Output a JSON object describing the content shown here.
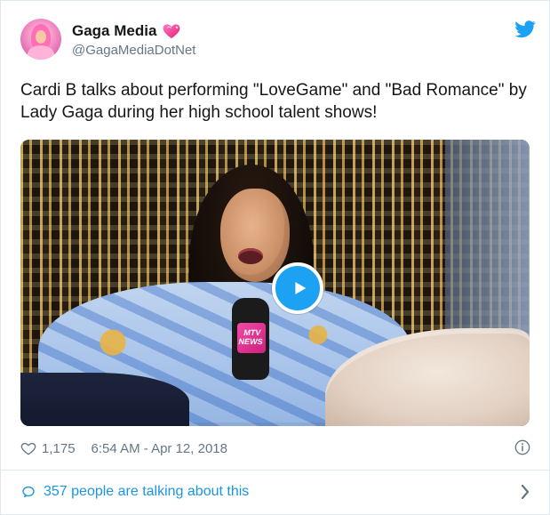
{
  "tweet": {
    "author": {
      "name": "Gaga Media",
      "handle": "@GagaMediaDotNet",
      "name_icon": "sparkling-heart-icon"
    },
    "platform_icon": "twitter-bird-icon",
    "text": "Cardi B talks about performing \"LoveGame\" and \"Bad Romance\" by Lady Gaga during her high school talent shows!",
    "media": {
      "type": "video",
      "play_icon": "play-icon",
      "watermark_text": "MTV NEWS"
    },
    "likes": "1,175",
    "timestamp": "6:54 AM - Apr 12, 2018",
    "info_icon": "info-icon",
    "talking_text": "357 people are talking about this",
    "talking_icon": "chat-bubble-icon",
    "chevron_icon": "chevron-right-icon",
    "colors": {
      "twitter_blue": "#1da1f2",
      "link_blue": "#1b95e0",
      "muted": "#657786",
      "border": "#e1e8ed",
      "heart_pink": "#ff4fa3"
    }
  }
}
